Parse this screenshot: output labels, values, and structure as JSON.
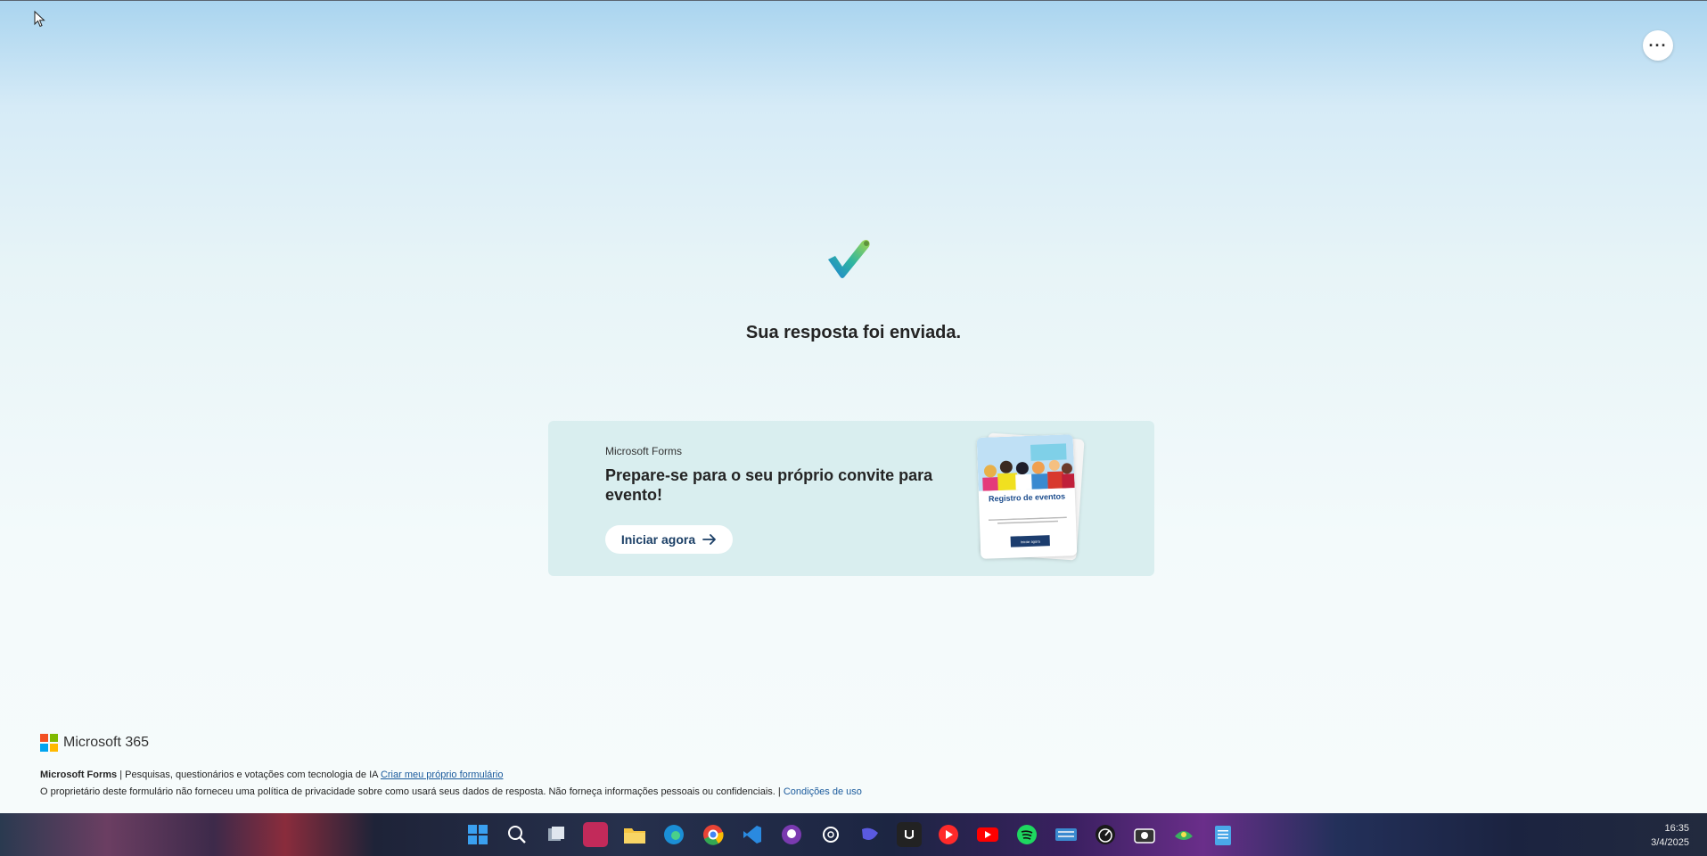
{
  "confirmation": {
    "message": "Sua resposta foi enviada."
  },
  "promo": {
    "brand": "Microsoft Forms",
    "title": "Prepare-se para o seu próprio convite para evento!",
    "button_label": "Iniciar agora",
    "image_heading": "Registro de eventos",
    "image_cta": "Iniciar agora"
  },
  "footer": {
    "logo_text": "Microsoft 365",
    "product": "Microsoft Forms",
    "tagline": " | Pesquisas, questionários e votações com tecnologia de IA ",
    "create_link": "Criar meu próprio formulário",
    "privacy_notice": "O proprietário deste formulário não forneceu uma política de privacidade sobre como usará seus dados de resposta. Não forneça informações pessoais ou confidenciais. | ",
    "terms_link": "Condições de uso"
  },
  "more_button_label": "···",
  "taskbar": {
    "icons": [
      "windows-start-icon",
      "search-icon",
      "task-view-icon",
      "app-icon",
      "file-explorer-icon",
      "edge-icon",
      "chrome-icon",
      "vscode-icon",
      "github-icon",
      "chatgpt-icon",
      "app-icon",
      "app-icon",
      "youtube-music-icon",
      "youtube-icon",
      "spotify-icon",
      "keyboard-icon",
      "speedometer-icon",
      "camera-icon",
      "app-icon",
      "notepad-icon"
    ],
    "time": "16:35",
    "date": "3/4/2025"
  },
  "colors": {
    "accent": "#1a5a9c",
    "card_bg": "#d9eeef"
  }
}
